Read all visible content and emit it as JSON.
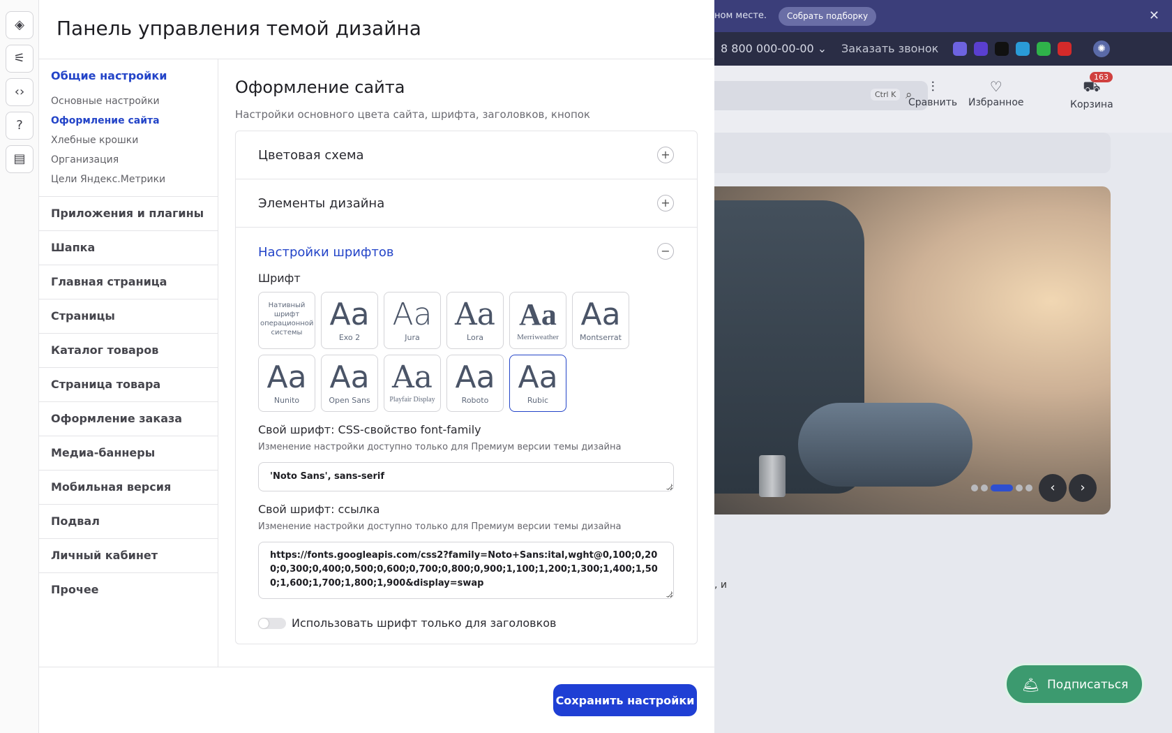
{
  "rail": {
    "icons": [
      "layers-icon",
      "sliders-icon",
      "code-icon",
      "help-icon",
      "chat-icon"
    ]
  },
  "panel": {
    "title": "Панель управления темой дизайна",
    "save_label": "Сохранить настройки"
  },
  "nav": {
    "group_title": "Общие настройки",
    "sub_items": [
      {
        "label": "Основные настройки"
      },
      {
        "label": "Оформление сайта",
        "active": true
      },
      {
        "label": "Хлебные крошки"
      },
      {
        "label": "Организация"
      },
      {
        "label": "Цели Яндекс.Метрики"
      }
    ],
    "sections": [
      "Приложения и плагины",
      "Шапка",
      "Главная страница",
      "Страницы",
      "Каталог товаров",
      "Страница товара",
      "Оформление заказа",
      "Медиа-баннеры",
      "Мобильная версия",
      "Подвал",
      "Личный кабинет",
      "Прочее"
    ]
  },
  "content": {
    "title": "Оформление сайта",
    "description": "Настройки основного цвета сайта, шрифта, заголовков, кнопок",
    "accordion": {
      "color_scheme": "Цветовая схема",
      "design_elements": "Элементы дизайна",
      "fonts": "Настройки шрифтов"
    },
    "font_label": "Шрифт",
    "font_tiles": [
      {
        "name": "Нативный шрифт операционной системы",
        "sample": ""
      },
      {
        "name": "Exo 2",
        "sample": "Aa"
      },
      {
        "name": "Jura",
        "sample": "Aa"
      },
      {
        "name": "Lora",
        "sample": "Aa"
      },
      {
        "name": "Merriweather",
        "sample": "Aa"
      },
      {
        "name": "Montserrat",
        "sample": "Aa"
      },
      {
        "name": "Nunito",
        "sample": "Aa"
      },
      {
        "name": "Open Sans",
        "sample": "Aa"
      },
      {
        "name": "Playfair Display",
        "sample": "Aa"
      },
      {
        "name": "Roboto",
        "sample": "Aa"
      },
      {
        "name": "Rubic",
        "sample": "Aa",
        "selected": true
      }
    ],
    "custom_family": {
      "label": "Свой шрифт: CSS-свойство font-family",
      "hint": "Изменение настройки доступно только для Премиум версии темы дизайна",
      "value": "'Noto Sans', sans-serif"
    },
    "custom_link": {
      "label": "Свой шрифт: ссылка",
      "hint": "Изменение настройки доступно только для Премиум версии темы дизайна",
      "value": "https://fonts.googleapis.com/css2?family=Noto+Sans:ital,wght@0,100;0,200;0,300;0,400;0,500;0,600;0,700;0,800;0,900;1,100;1,200;1,300;1,400;1,500;1,600;1,700;1,800;1,900&display=swap"
    },
    "headings_only_label": "Использовать шрифт только для заголовков",
    "headings_only_on": false
  },
  "site": {
    "promo_fragment": "ном месте.",
    "collect_label": "Собрать подборку",
    "phone": "8 800 000-00-00",
    "callback": "Заказать звонок",
    "search_shortcut": "Ctrl K",
    "compare": "Сравнить",
    "favorites": "Избранное",
    "cart": "Корзина",
    "cart_count": "163",
    "text_fragment": ", и",
    "subscribe": "Подписаться"
  },
  "colors": {
    "accent": "#2344c8",
    "save_button": "#1f3fd4",
    "subscribe": "#3c9a6f",
    "badge": "#d0403f"
  }
}
